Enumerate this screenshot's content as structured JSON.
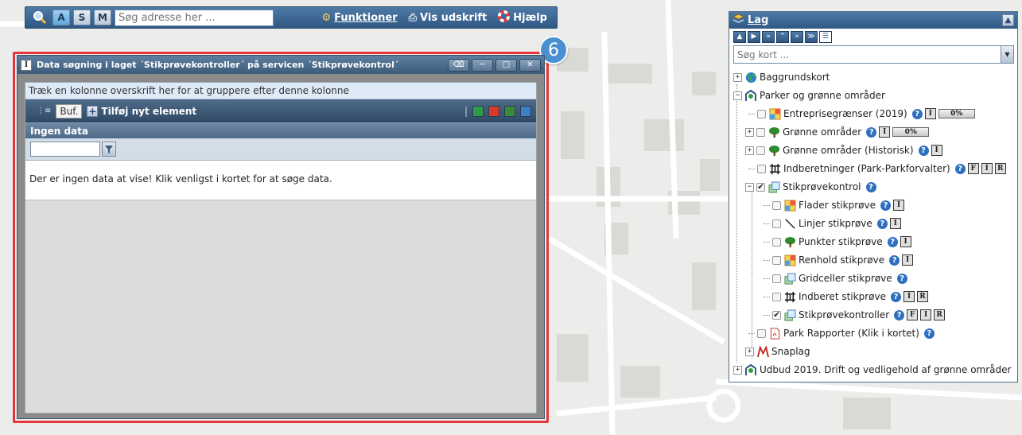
{
  "toolbar": {
    "keys": [
      "A",
      "S",
      "M"
    ],
    "search_placeholder": "Søg adresse her ...",
    "funktioner": "Funktioner",
    "vis_udskrift": "Vis udskrift",
    "hjaelp": "Hjælp"
  },
  "badge": "6",
  "datawin": {
    "title": "Data søgning i laget ´Stikprøvekontroller´ på servicen ´Stikprøvekontrol´",
    "group_hint": "Træk en kolonne overskrift her for at gruppere efter denne kolonne",
    "buf_label": "Buf.",
    "add_label": "Tilføj nyt element",
    "nodata_header": "Ingen data",
    "nodata_message": "Der er ingen data at vise! Klik venligst i kortet for at søge data."
  },
  "layers": {
    "title": "Lag",
    "search_placeholder": "Søg kort ...",
    "items": [
      {
        "label": "Baggrundskort",
        "icon": "globe-icon"
      },
      {
        "label": "Parker og grønne områder",
        "icon": "park-icon"
      },
      {
        "label": "Entreprisegrænser (2019)",
        "icon": "polygon-icon",
        "pct": "0%"
      },
      {
        "label": "Grønne områder",
        "icon": "tree-icon",
        "pct": "0%"
      },
      {
        "label": "Grønne områder (Historisk)",
        "icon": "tree-icon"
      },
      {
        "label": "Indberetninger (Park-Parkforvalter)",
        "icon": "network-icon"
      },
      {
        "label": "Stikprøvekontrol",
        "icon": "grid-icon"
      },
      {
        "label": "Flader stikprøve",
        "icon": "polygon-icon"
      },
      {
        "label": "Linjer stikprøve",
        "icon": "line-icon"
      },
      {
        "label": "Punkter stikprøve",
        "icon": "tree-icon"
      },
      {
        "label": "Renhold stikprøve",
        "icon": "polygon-icon"
      },
      {
        "label": "Gridceller stikprøve",
        "icon": "grid-icon"
      },
      {
        "label": "Indberet stikprøve",
        "icon": "network-icon"
      },
      {
        "label": "Stikprøvekontroller",
        "icon": "grid-icon"
      },
      {
        "label": "Park Rapporter (Klik i kortet)",
        "icon": "pdf-icon"
      },
      {
        "label": "Snaplag",
        "icon": "snap-icon"
      },
      {
        "label": "Udbud 2019. Drift og vedligehold af grønne områder",
        "icon": "park-icon"
      }
    ]
  },
  "colors": {
    "accent": "#2f5883",
    "highlight": "#e8353a",
    "badge": "#4a8fd1"
  }
}
